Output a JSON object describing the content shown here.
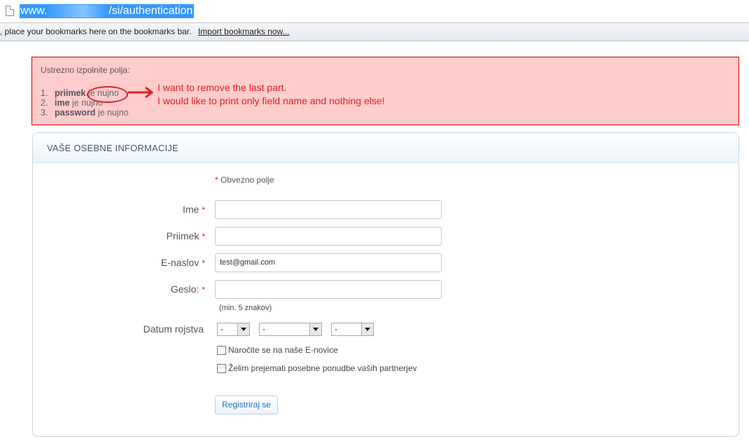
{
  "browser": {
    "url_prefix": "www.",
    "url_suffix": "/si/authentication",
    "bookmarks_text": ", place your bookmarks here on the bookmarks bar.",
    "import_link": "Import bookmarks now..."
  },
  "error": {
    "title": "Ustrezno izpolnite polja:",
    "items": [
      {
        "num": "1.",
        "field": "priimek",
        "suffix": " je nujno"
      },
      {
        "num": "2.",
        "field": "ime",
        "suffix": " je nujno"
      },
      {
        "num": "3.",
        "field": "password",
        "suffix": " je nujno"
      }
    ]
  },
  "annotation": {
    "line1": "I want to remove the last part.",
    "line2": "I would like to print only field name and nothing else!"
  },
  "form": {
    "header": "VAŠE OSEBNE INFORMACIJE",
    "required_star": "*",
    "required_note": "Obvezno polje",
    "fields": {
      "ime": {
        "label": "Ime",
        "value": ""
      },
      "priimek": {
        "label": "Priimek",
        "value": ""
      },
      "email": {
        "label": "E-naslov",
        "value": "test@gmail.com"
      },
      "geslo": {
        "label": "Geslo:",
        "value": ""
      }
    },
    "password_hint": "(min. 5 znakov)",
    "birthdate": {
      "label": "Datum rojstva",
      "day": "-",
      "month": "-",
      "year": "-"
    },
    "newsletter_label": "Naročite se na naše E-novice",
    "partners_label": "Želim prejemati posebne ponudbe vaših partnerjev",
    "submit_label": "Registriraj se"
  },
  "colors": {
    "annotation": "#e02020",
    "error_bg": "#ffcccc",
    "error_border": "#cc0000",
    "selection": "#3399ff"
  }
}
